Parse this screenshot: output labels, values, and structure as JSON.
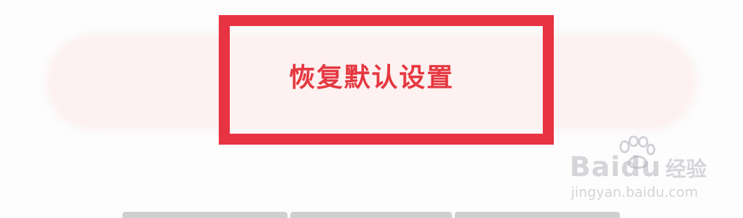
{
  "reset_button": {
    "label": "恢复默认设置"
  },
  "colors": {
    "accent": "#e53841",
    "highlight_border": "#e73342",
    "button_background": "#fdf1f1"
  },
  "watermark": {
    "brand": "Baidu",
    "brand_cn": "经验",
    "url": "jingyan.baidu.com"
  }
}
